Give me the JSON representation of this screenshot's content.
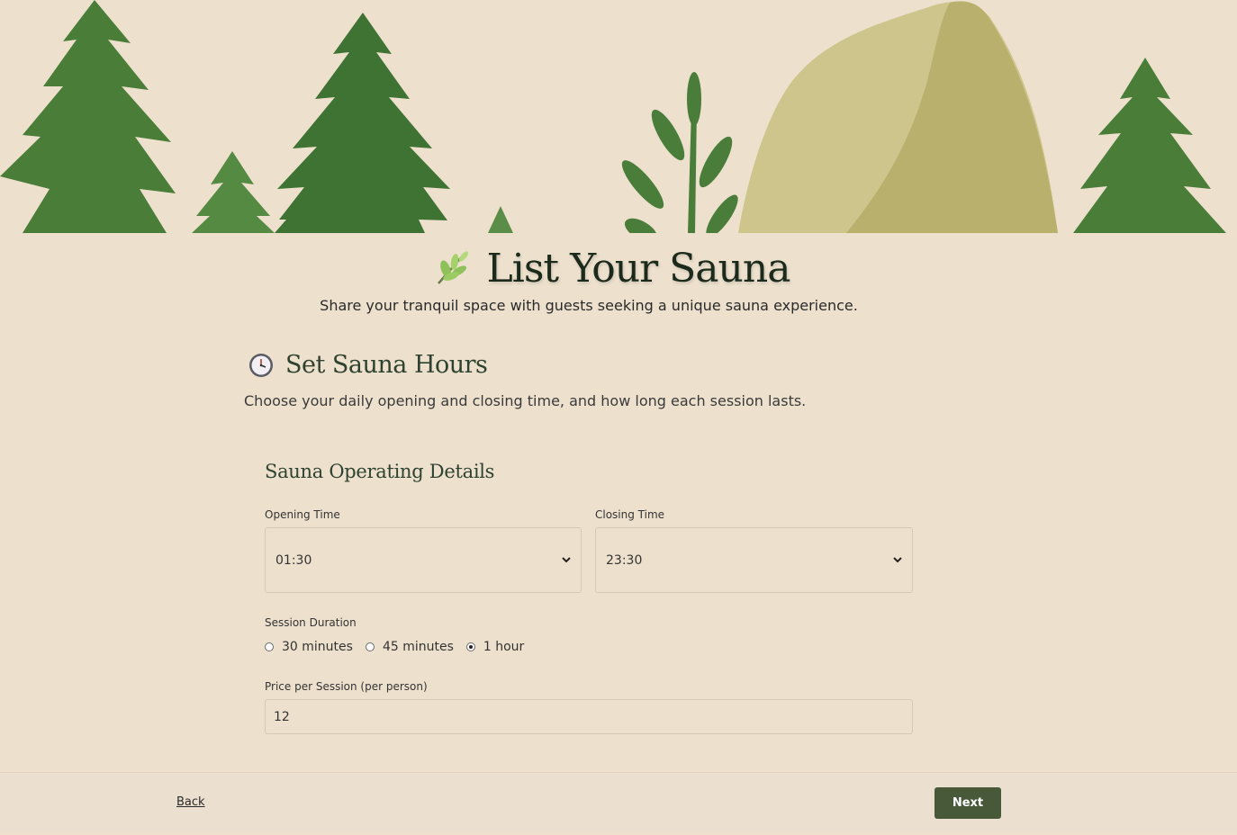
{
  "header": {
    "title": "List Your Sauna",
    "subtitle": "Share your tranquil space with guests seeking a unique sauna experience."
  },
  "section": {
    "title": "Set Sauna Hours",
    "description": "Choose your daily opening and closing time, and how long each session lasts."
  },
  "card": {
    "title": "Sauna Operating Details",
    "opening_time": {
      "label": "Opening Time",
      "value": "01:30"
    },
    "closing_time": {
      "label": "Closing Time",
      "value": "23:30"
    },
    "session_duration": {
      "label": "Session Duration",
      "options": [
        {
          "label": "30 minutes",
          "selected": false
        },
        {
          "label": "45 minutes",
          "selected": false
        },
        {
          "label": "1 hour",
          "selected": true
        }
      ]
    },
    "price": {
      "label": "Price per Session (per person)",
      "value": "12"
    }
  },
  "footer": {
    "back_label": "Back",
    "next_label": "Next"
  },
  "colors": {
    "background": "#ede1ce",
    "tree_green": "#4f7f3a",
    "rock": "#c7c283",
    "button": "#48593a"
  },
  "icons": {
    "title": "leaf-sprig-icon",
    "section": "clock-icon",
    "select": "chevron-down-icon"
  }
}
